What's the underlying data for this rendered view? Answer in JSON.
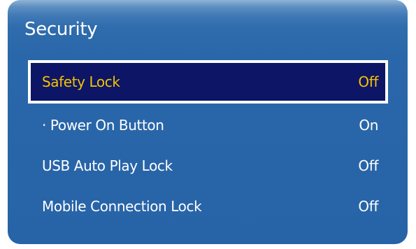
{
  "window": {
    "title": "Security"
  },
  "menu": {
    "items": [
      {
        "label": "Safety Lock",
        "value": "Off",
        "selected": true
      },
      {
        "label": "Power On Button",
        "value": "On",
        "selected": false,
        "sub_item": true
      },
      {
        "label": "USB Auto Play Lock",
        "value": "Off",
        "selected": false
      },
      {
        "label": "Mobile Connection Lock",
        "value": "Off",
        "selected": false
      }
    ]
  },
  "colors": {
    "panel_blue": "#2a67aa",
    "highlight_bg": "#0d1566",
    "highlight_border": "#ffffff",
    "highlight_text": "#f5c400",
    "text": "#ffffff"
  }
}
